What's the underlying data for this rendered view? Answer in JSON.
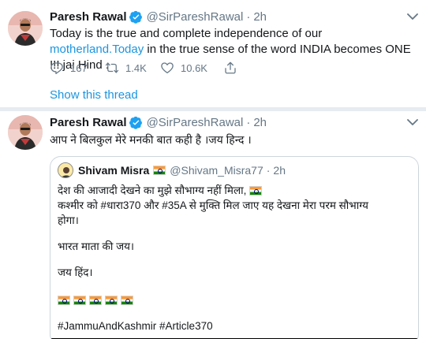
{
  "tweet1": {
    "name": "Paresh Rawal",
    "handle": "@SirPareshRawal",
    "separator": "·",
    "time": "2h",
    "text_a": "Today is the true and complete independence of our ",
    "text_link": "motherland.Today",
    "text_b": "  in the true sense of the word INDIA becomes ONE !!! jai Hind .",
    "reply_count": "167",
    "retweet_count": "1.4K",
    "like_count": "10.6K",
    "show_thread": "Show this thread"
  },
  "tweet2": {
    "name": "Paresh Rawal",
    "handle": "@SirPareshRawal",
    "separator": "·",
    "time": "2h",
    "text": "आप ने बिलकुल मेरे मनकी बात कही है ।जय हिन्द ।",
    "quote": {
      "name": "Shivam Misra",
      "handle": "@Shivam_Misra77",
      "separator": "·",
      "time": "2h",
      "line1": "देश की आजादी देखने का मुझे सौभाग्य नहीं मिला,",
      "line2": "कश्मीर को #धारा370 और #35A से मुक्ति मिल जाए यह देखना मेरा परम सौभाग्य",
      "line3": "होगा।",
      "line4": "भारत माता की जय।",
      "line5": "जय हिंद।",
      "hashtags": "#JammuAndKashmir #Article370"
    }
  },
  "colors": {
    "link": "#1b95e0",
    "muted": "#657786",
    "verified": "#1da1f2",
    "border": "#e6ecf0"
  },
  "icons": [
    "verified-badge-icon",
    "chevron-down-icon",
    "reply-icon",
    "retweet-icon",
    "like-icon",
    "share-icon",
    "india-flag-icon"
  ]
}
